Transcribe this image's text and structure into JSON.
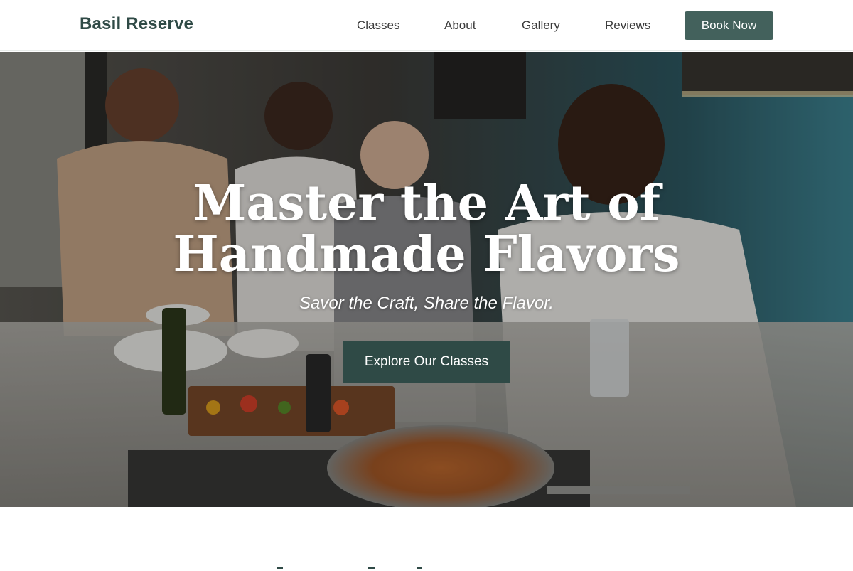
{
  "header": {
    "logo": "Basil Reserve",
    "nav": {
      "classes": "Classes",
      "about": "About",
      "gallery": "Gallery",
      "reviews": "Reviews"
    },
    "cta": "Book Now"
  },
  "hero": {
    "title_line1": "Master the Art of",
    "title_line2": "Handmade Flavors",
    "subtitle": "Savor the Craft, Share the Flavor.",
    "cta": "Explore Our Classes",
    "image": "photo of four people cooking together in a kitchen"
  },
  "colors": {
    "brand": "#2f4a46",
    "book_button": "#43615c",
    "text": "#3a3a3a",
    "background": "#ffffff"
  }
}
